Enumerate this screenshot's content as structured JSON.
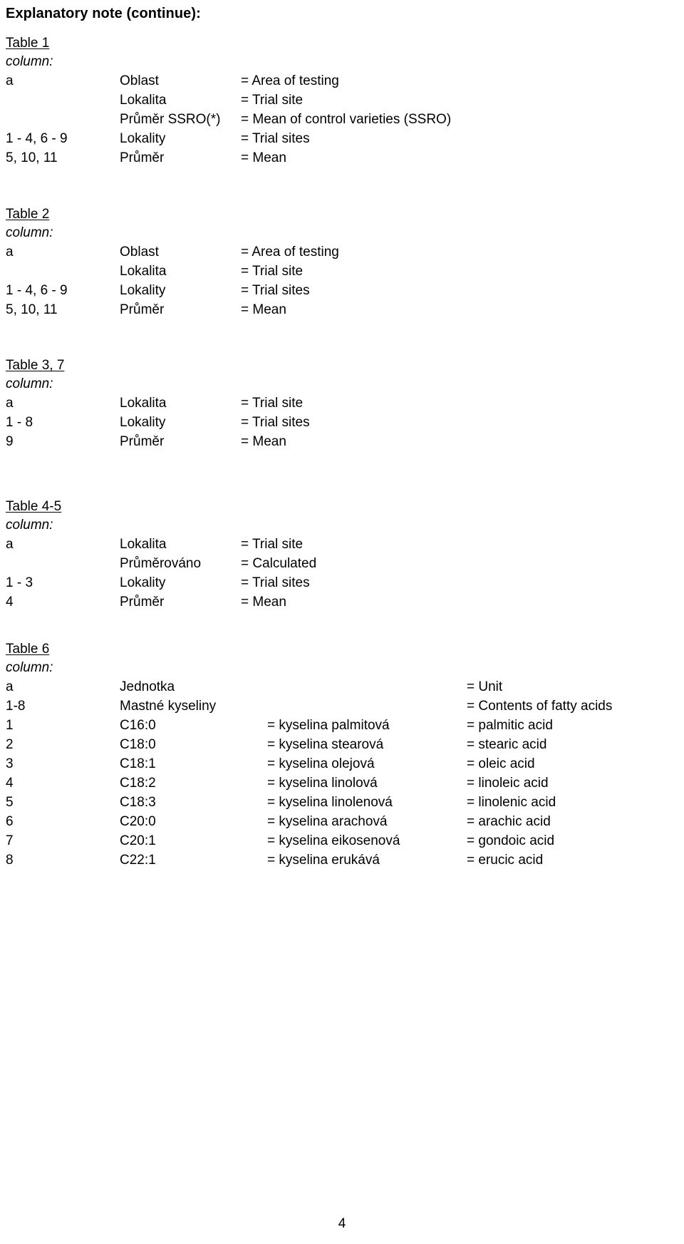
{
  "document": {
    "title": "Explanatory note (continue):",
    "page_number": "4",
    "column_label": "column:"
  },
  "sections": [
    {
      "heading": "Table 1",
      "sub": "column:",
      "layout": "three",
      "rows": [
        {
          "key": "a",
          "cz": "Oblast",
          "en": "= Area of testing"
        },
        {
          "key": "",
          "cz": "Lokalita",
          "en": "= Trial site"
        },
        {
          "key": "",
          "cz": "Průměr SSRO(*)",
          "en": "= Mean of control varieties (SSRO)"
        },
        {
          "key": "1 - 4, 6 - 9",
          "cz": "Lokality",
          "en": "= Trial sites"
        },
        {
          "key": "5, 10, 11",
          "cz": "Průměr",
          "en": "= Mean"
        }
      ]
    },
    {
      "heading": "Table 2",
      "sub": "column:",
      "layout": "three",
      "rows": [
        {
          "key": "a",
          "cz": "Oblast",
          "en": "= Area of testing"
        },
        {
          "key": "",
          "cz": "Lokalita",
          "en": "= Trial site"
        },
        {
          "key": "1 - 4, 6 - 9",
          "cz": "Lokality",
          "en": "= Trial sites"
        },
        {
          "key": "5, 10, 11",
          "cz": "Průměr",
          "en": "= Mean"
        }
      ]
    },
    {
      "heading": "Table 3, 7",
      "sub": "column:",
      "layout": "three",
      "rows": [
        {
          "key": "a",
          "cz": "Lokalita",
          "en": "= Trial site"
        },
        {
          "key": "1 - 8",
          "cz": "Lokality",
          "en": "= Trial sites"
        },
        {
          "key": "9",
          "cz": "Průměr",
          "en": "= Mean"
        }
      ]
    },
    {
      "heading": "Table 4-5",
      "sub": "column:",
      "layout": "three",
      "rows": [
        {
          "key": "a",
          "cz": "Lokalita",
          "en": "= Trial site"
        },
        {
          "key": "",
          "cz": "Průměrováno",
          "en": "= Calculated"
        },
        {
          "key": "1 - 3",
          "cz": "Lokality",
          "en": "= Trial sites"
        },
        {
          "key": "4",
          "cz": "Průměr",
          "en": "= Mean"
        }
      ]
    },
    {
      "heading": "Table 6",
      "sub": "column:",
      "layout": "four",
      "rows": [
        {
          "key": "a",
          "code": "Jednotka",
          "czn": "",
          "enn": "= Unit"
        },
        {
          "key": "1-8",
          "code": "Mastné kyseliny",
          "czn": "",
          "enn": "= Contents of fatty acids"
        },
        {
          "key": "1",
          "code": "C16:0",
          "czn": "= kyselina palmitová",
          "enn": "= palmitic acid"
        },
        {
          "key": "2",
          "code": "C18:0",
          "czn": "= kyselina stearová",
          "enn": "= stearic acid"
        },
        {
          "key": "3",
          "code": "C18:1",
          "czn": "= kyselina olejová",
          "enn": "= oleic acid"
        },
        {
          "key": "4",
          "code": "C18:2",
          "czn": "= kyselina linolová",
          "enn": "= linoleic acid"
        },
        {
          "key": "5",
          "code": "C18:3",
          "czn": "= kyselina linolenová",
          "enn": "= linolenic acid"
        },
        {
          "key": "6",
          "code": "C20:0",
          "czn": "= kyselina arachová",
          "enn": "= arachic acid"
        },
        {
          "key": "7",
          "code": "C20:1",
          "czn": "= kyselina eikosenová",
          "enn": "= gondoic acid"
        },
        {
          "key": "8",
          "code": "C22:1",
          "czn": "= kyselina erukává",
          "enn": "= erucic acid"
        }
      ]
    }
  ],
  "section_tops": [
    48,
    288,
    500,
    698,
    898
  ]
}
